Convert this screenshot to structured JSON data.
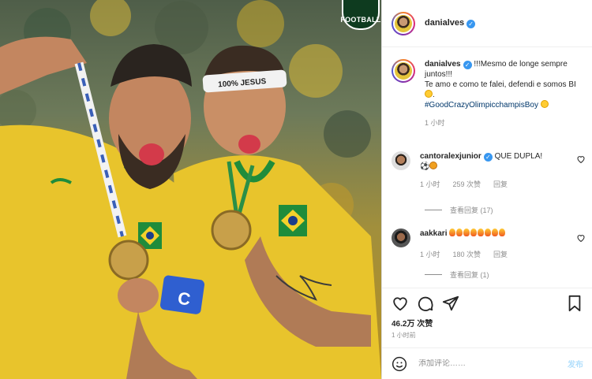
{
  "photo": {
    "logo_text": "FOOTBALL",
    "headband_text": "100% JESUS",
    "armband_letter": "C"
  },
  "header": {
    "username": "danialves"
  },
  "caption": {
    "username": "danialves",
    "text_line1": "!!!Mesmo de longe sempre juntos!!!",
    "text_line2": "Te amo e como te falei, defendi e somos BI",
    "hashtag": "#GoodCrazyOlimpicchampisBoy",
    "time": "1 小时"
  },
  "comments": [
    {
      "username": "cantoralexjunior",
      "text": "QUE DUPLA!",
      "time": "1 小时",
      "likes": "259 次赞",
      "reply": "回复",
      "view_replies": "查看回复 (17)"
    },
    {
      "username": "aakkari",
      "text": "",
      "time": "1 小时",
      "likes": "180 次赞",
      "reply": "回复",
      "view_replies": "查看回复 (1)"
    }
  ],
  "actions": {
    "likes_count": "46.2万 次赞",
    "time_ago": "1 小时前"
  },
  "add_comment": {
    "placeholder": "添加评论……",
    "post_label": "发布"
  },
  "colors": {
    "verified": "#3897f0",
    "hashtag": "#00376b",
    "post_button_disabled": "#b2dffc",
    "brazil_yellow": "#e8c42c",
    "brazil_green": "#1f8c3b"
  }
}
